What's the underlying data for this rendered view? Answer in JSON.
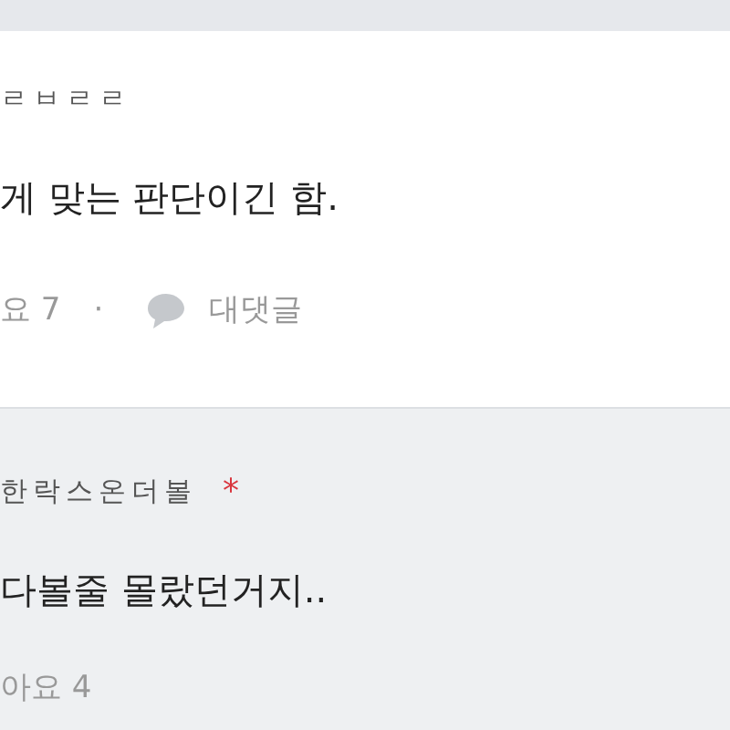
{
  "comments": [
    {
      "author": "ㄹㅂㄹㄹ",
      "text": "게 맞는 판단이긴 함.",
      "likes": "요 7",
      "separator": "·",
      "reply": "대댓글",
      "kind": "comment"
    },
    {
      "author": "한락스온더볼",
      "badge": "*",
      "text": "다볼줄 몰랐던거지..",
      "likes": "아요 4",
      "kind": "reply"
    }
  ]
}
